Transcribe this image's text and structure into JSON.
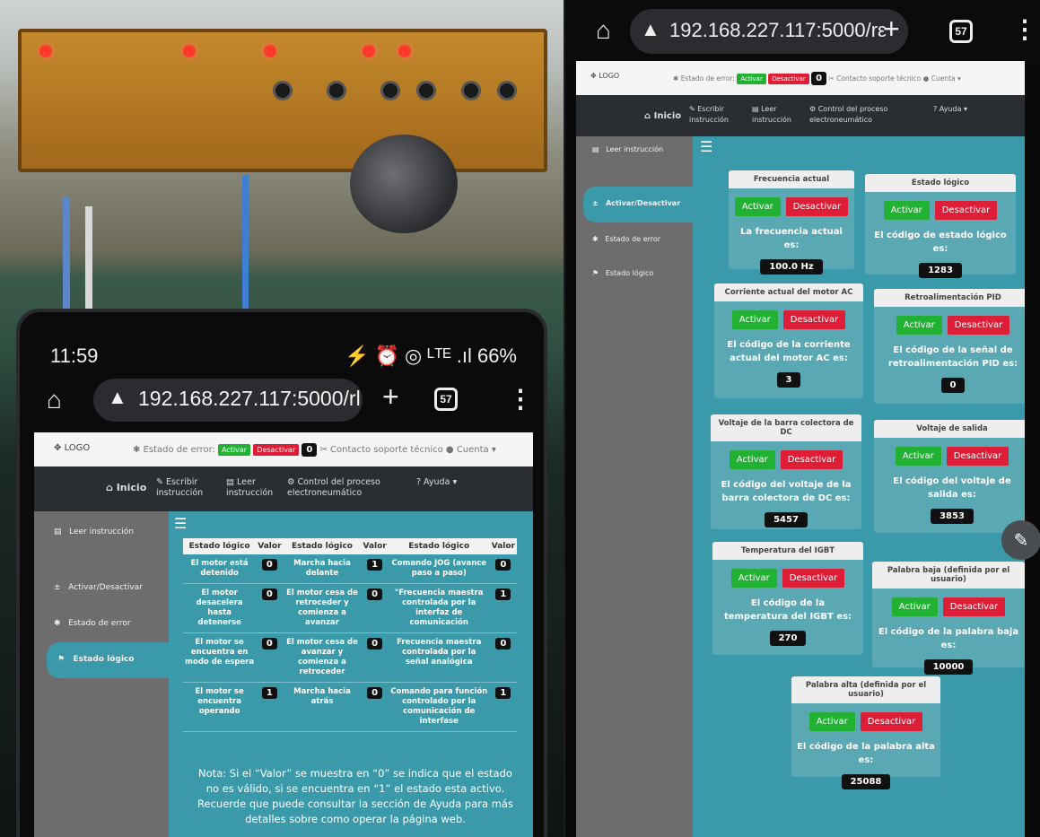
{
  "browser": {
    "time": "11:59",
    "status_icons": "⚡ ⏰ ◎ ᴸᵀᴱ .ıl 66%",
    "url_left": "192.168.227.117:5000/rl",
    "url_right": "192.168.227.117:5000/rε",
    "tab_count": "57"
  },
  "topnav": {
    "logo": "LOGO",
    "error_label": "Estado de error:",
    "activate": "Activar",
    "deactivate": "Desactivar",
    "error_count": "0",
    "support": "Contacto soporte técnico",
    "account": "Cuenta"
  },
  "mainnav": {
    "home": "Inicio",
    "write": "Escribir instrucción",
    "read": "Leer instrucción",
    "control": "Control del proceso electroneumático",
    "help": "? Ayuda"
  },
  "sidebar": {
    "read": "Leer instrucción",
    "activate": "Activar/Desactivar",
    "error": "Estado de error",
    "logic": "Estado lógico"
  },
  "table": {
    "headers": [
      "Estado lógico",
      "Valor",
      "Estado lógico",
      "Valor",
      "Estado lógico",
      "Valor"
    ],
    "rows": [
      [
        "El motor está detenido",
        "0",
        "Marcha hacia delante",
        "1",
        "Comando JOG (avance paso a paso)",
        "0"
      ],
      [
        "El motor desacelera hasta detenerse",
        "0",
        "El motor cesa de retroceder y comienza a avanzar",
        "0",
        "\"Frecuencia maestra controlada por la interfaz de comunicación",
        "1"
      ],
      [
        "El motor se encuentra en modo de espera",
        "0",
        "El motor cesa de avanzar y comienza a retroceder",
        "0",
        "Frecuencia maestra controlada por la señal analógica",
        "0"
      ],
      [
        "El motor se encuentra operando",
        "1",
        "Marcha hacia atrás",
        "0",
        "Comando para función controlado por la comunicación de interfase",
        "1"
      ]
    ],
    "note": "Nota: Si el “Valor” se muestra en “0” se indica que el estado no es válido, si se encuentra en “1” el estado esta activo. Recuerde que puede consultar la sección de Ayuda para más detalles sobre como operar la página web."
  },
  "cards": {
    "activate": "Activar",
    "deactivate": "Desactivar",
    "freq_title": "Frecuencia actual",
    "freq_text": "La frecuencia actual es:",
    "freq_val": "100.0 Hz",
    "logic_title": "Estado lógico",
    "logic_text": "El código de estado lógico es:",
    "logic_val": "1283",
    "current_title": "Corriente actual del motor AC",
    "current_text": "El código de la corriente actual del motor AC es:",
    "current_val": "3",
    "pid_title": "Retroalimentación PID",
    "pid_text": "El código de la señal de retroalimentación PID es:",
    "pid_val": "0",
    "dc_title": "Voltaje de la barra colectora de DC",
    "dc_text": "El código del voltaje de la barra colectora de DC es:",
    "dc_val": "5457",
    "out_title": "Voltaje de salida",
    "out_text": "El código del voltaje de salida es:",
    "out_val": "3853",
    "igbt_title": "Temperatura del IGBT",
    "igbt_text": "El código de la temperatura del IGBT es:",
    "igbt_val": "270",
    "low_title": "Palabra baja (definida por el usuario)",
    "low_text": "El código de la palabra baja es:",
    "low_val": "10000",
    "high_title": "Palabra alta (definida por el usuario)",
    "high_text": "El código de la palabra alta es:",
    "high_val": "25088"
  }
}
